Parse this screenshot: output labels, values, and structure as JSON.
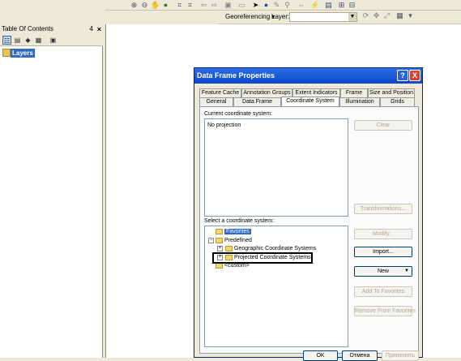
{
  "toolbar": {
    "icons": [
      "zoom-in-icon",
      "zoom-out-icon",
      "pan-icon",
      "globe-icon",
      "full-extent-icon",
      "fixed-zoom-icon",
      "back-icon",
      "forward-icon",
      "select-features-icon",
      "select-elements-icon",
      "identify-icon",
      "info-icon",
      "find-icon",
      "measure-icon",
      "hyperlink-icon",
      "html-popup-icon"
    ]
  },
  "georef": {
    "menu_label": "Georeferencing",
    "layer_label": "Layer:",
    "layer_value": ""
  },
  "toc": {
    "title": "Table Of Contents",
    "pin": "4",
    "close": "×",
    "root_label": "Layers"
  },
  "dialog": {
    "title": "Data Frame Properties",
    "help": "?",
    "close": "X",
    "tabs_row1": [
      "Feature Cache",
      "Annotation Groups",
      "Extent Indicators",
      "Frame",
      "Size and Position"
    ],
    "tabs_row2": [
      "General",
      "Data Frame",
      "Coordinate System",
      "Illumination",
      "Grids"
    ],
    "current_label": "Current coordinate system:",
    "current_value": "No projection",
    "select_label": "Select a coordinate system:",
    "buttons": {
      "clear": "Clear",
      "transformations": "Transformations...",
      "modify": "Modify...",
      "import": "Import...",
      "new": "New",
      "add_favorites": "Add To Favorites",
      "remove_favorites": "Remove From Favorites"
    },
    "tree": {
      "favorites": "Favorites",
      "predefined": "Predefined",
      "geographic": "Geographic Coordinate Systems",
      "projected": "Projected Coordinate Systems",
      "custom": "<custom>"
    },
    "bottom": {
      "ok": "OK",
      "cancel": "Отмена",
      "apply": "Применить"
    }
  }
}
